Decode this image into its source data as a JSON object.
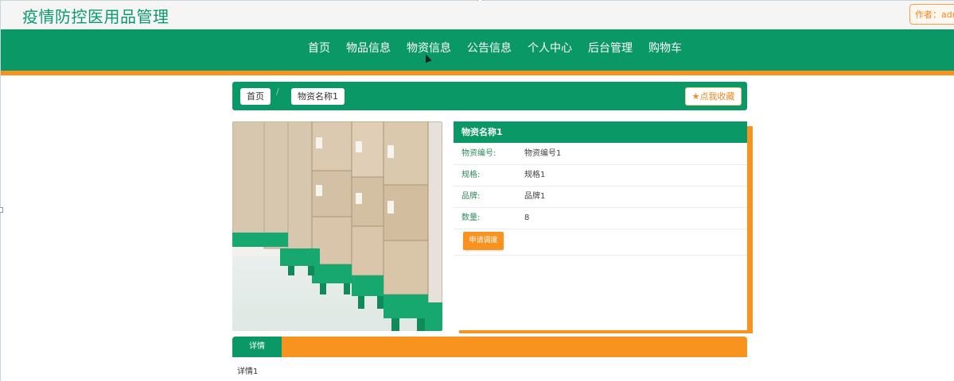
{
  "header": {
    "site_title": "疫情防控医用品管理",
    "author_label": "作者：adm"
  },
  "nav": {
    "items": [
      {
        "label": "首页"
      },
      {
        "label": "物品信息"
      },
      {
        "label": "物资信息"
      },
      {
        "label": "公告信息"
      },
      {
        "label": "个人中心"
      },
      {
        "label": "后台管理"
      },
      {
        "label": "购物车"
      }
    ]
  },
  "breadcrumb": {
    "home": "首页",
    "separator": "/",
    "current": "物资名称1",
    "favorite_label": "点我收藏",
    "favorite_icon": "star-icon"
  },
  "product": {
    "image_alt": "warehouse-boxes-image",
    "title": "物资名称1",
    "fields": [
      {
        "key": "物资编号:",
        "value": "物资编号1"
      },
      {
        "key": "规格:",
        "value": "规格1"
      },
      {
        "key": "品牌:",
        "value": "品牌1"
      },
      {
        "key": "数量:",
        "value": "8"
      }
    ],
    "apply_label": "申请调度"
  },
  "detail": {
    "tab_label": "详情",
    "content": "详情1"
  },
  "colors": {
    "primary_green": "#0a9966",
    "accent_orange": "#f7931e",
    "title_green": "#0a9a6b"
  }
}
